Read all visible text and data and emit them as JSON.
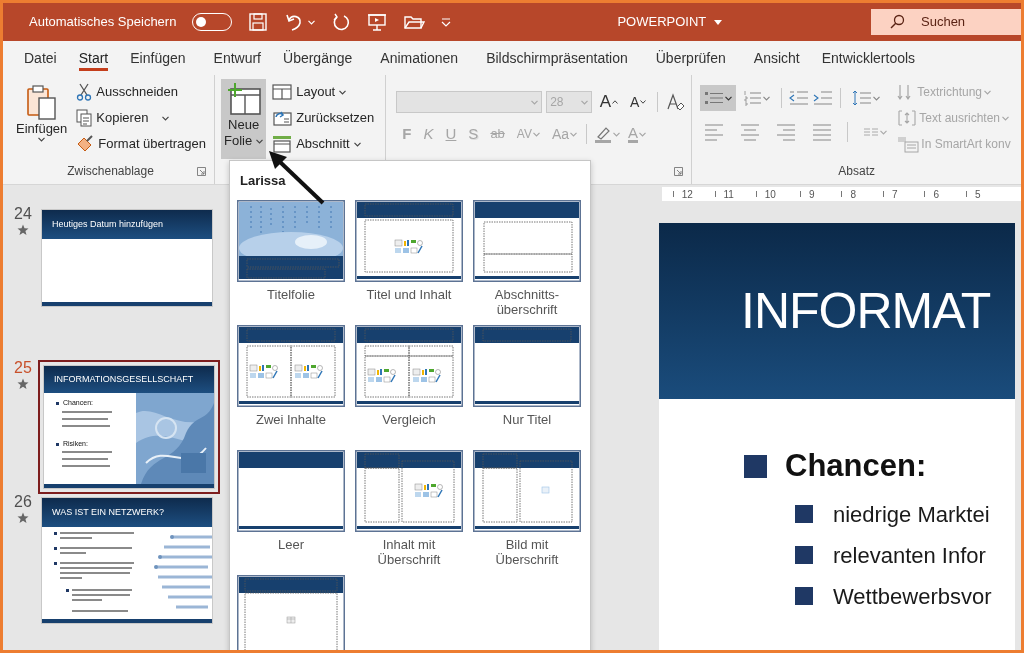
{
  "titlebar": {
    "autosave_label": "Automatisches Speichern",
    "autosave_on": false,
    "app_title": "POWERPOINT",
    "search_placeholder": "Suchen"
  },
  "tabs": [
    {
      "label": "Datei",
      "selected": false
    },
    {
      "label": "Start",
      "selected": true
    },
    {
      "label": "Einfügen",
      "selected": false
    },
    {
      "label": "Entwurf",
      "selected": false
    },
    {
      "label": "Übergänge",
      "selected": false
    },
    {
      "label": "Animationen",
      "selected": false
    },
    {
      "label": "Bildschirmpräsentation",
      "selected": false
    },
    {
      "label": "Überprüfen",
      "selected": false
    },
    {
      "label": "Ansicht",
      "selected": false
    },
    {
      "label": "Entwicklertools",
      "selected": false
    }
  ],
  "clipboard": {
    "paste_label": "Einfügen",
    "group_label": "Zwischenablage",
    "commands": [
      {
        "kind": "cut",
        "label": "Ausschneiden"
      },
      {
        "kind": "copy",
        "label": "Kopieren"
      },
      {
        "kind": "painter",
        "label": "Format übertragen"
      }
    ]
  },
  "slides_group": {
    "new_slide": {
      "line_1": "Neue",
      "line_2": "Folie",
      "expanded": true
    },
    "commands": [
      {
        "kind": "layout",
        "label": "Layout"
      },
      {
        "kind": "reset",
        "label": "Zurücksetzen"
      },
      {
        "kind": "section",
        "label": "Abschnitt"
      }
    ]
  },
  "font_group": {
    "disabled": true,
    "size": "28",
    "size_buttons": [
      {
        "kind": "grow",
        "label": "A"
      },
      {
        "kind": "shrink",
        "label": "A"
      }
    ],
    "style_buttons": [
      {
        "kind": "bold",
        "label": "F"
      },
      {
        "kind": "italic",
        "label": "K"
      },
      {
        "kind": "underline",
        "label": "U"
      },
      {
        "kind": "shadow",
        "label": "S"
      },
      {
        "kind": "strike",
        "label": "ab"
      },
      {
        "kind": "spacing",
        "label": "AV"
      },
      {
        "kind": "case",
        "label": "Aa"
      }
    ],
    "font_color_label": "A"
  },
  "paragraph_group": {
    "group_label": "Absatz",
    "bullets_selected": true,
    "commands": [
      {
        "kind": "text_direction",
        "label": "Textrichtung",
        "disabled": true
      },
      {
        "kind": "align_text",
        "label": "Text ausrichten",
        "disabled": true
      },
      {
        "kind": "smartart",
        "label": "In SmartArt konv",
        "disabled": true
      }
    ]
  },
  "layout_gallery": {
    "heading": "Larissa",
    "layouts": [
      {
        "kind": "title",
        "label": "Titelfolie"
      },
      {
        "kind": "title_content",
        "label": "Titel und Inhalt"
      },
      {
        "kind": "section",
        "label": "Abschnitts-überschrift"
      },
      {
        "kind": "two_content",
        "label": "Zwei Inhalte"
      },
      {
        "kind": "comparison",
        "label": "Vergleich"
      },
      {
        "kind": "title_only",
        "label": "Nur Titel"
      },
      {
        "kind": "blank",
        "label": "Leer"
      },
      {
        "kind": "content_caption",
        "label": "Inhalt mit Überschrift"
      },
      {
        "kind": "picture_caption",
        "label": "Bild mit Überschrift"
      },
      {
        "kind": "title_table"
      }
    ]
  },
  "slide_panel": [
    {
      "number": "24",
      "title": "Heutiges Datum hinzufügen",
      "kind": "blank",
      "selected": false
    },
    {
      "number": "25",
      "title": "INFORMATIONSGESELLSCHAFT",
      "kind": "bullets_picture",
      "selected": true,
      "bullets": [
        "Chancen:",
        "Risiken:"
      ]
    },
    {
      "number": "26",
      "title": "WAS IST EIN NETZWERK?",
      "kind": "bullets_graphic",
      "selected": false
    }
  ],
  "editor": {
    "ruler": [
      "12",
      "11",
      "10",
      "9",
      "8",
      "7",
      "6",
      "5"
    ],
    "slide_title": "INFORMAT",
    "bullets": [
      {
        "text": "Chancen:",
        "children": [
          {
            "text": "niedrige Marktei"
          },
          {
            "text": "relevanten Infor"
          },
          {
            "text": "Wettbewerbsvor"
          }
        ]
      }
    ]
  }
}
